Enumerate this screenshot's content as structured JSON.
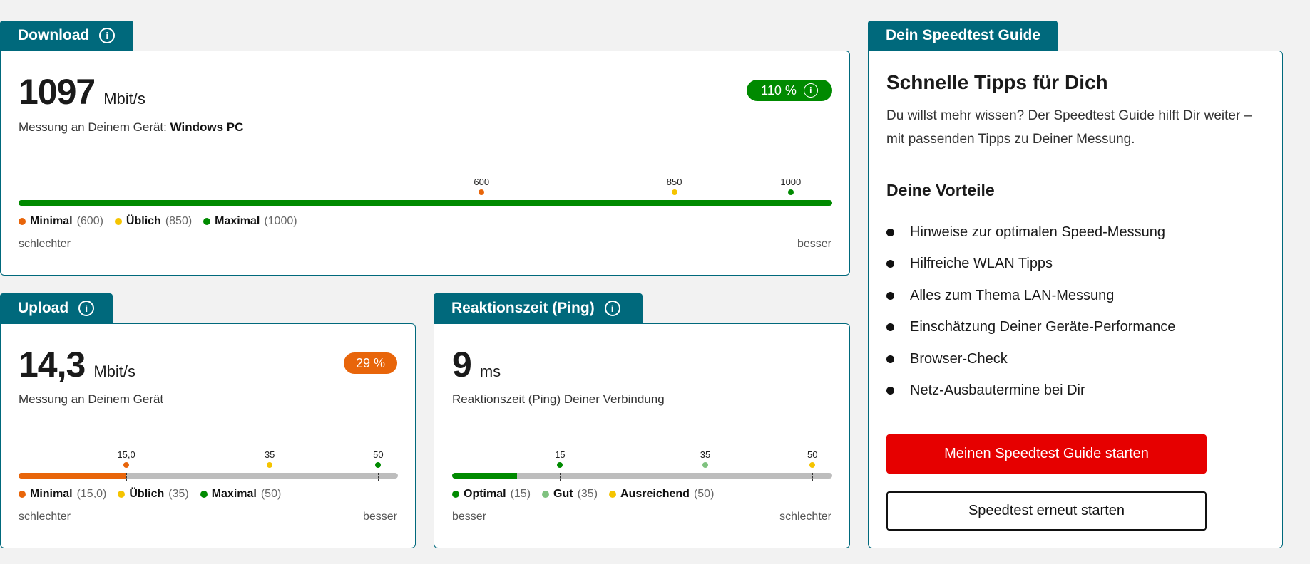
{
  "colors": {
    "teal": "#00697c",
    "green": "#008a00",
    "orange": "#e8650a",
    "yellow": "#f5c400",
    "lightgreen": "#7fc27f",
    "red": "#e60000",
    "track": "#bdbdbd"
  },
  "download": {
    "tab_label": "Download",
    "value": "1097",
    "unit": "Mbit/s",
    "device_prefix": "Messung an Deinem Gerät:",
    "device_name": "Windows PC",
    "badge": "110 %",
    "fill_fraction": 1.0,
    "markers": [
      {
        "label": "600",
        "fraction": 0.569,
        "color": "#e8650a"
      },
      {
        "label": "850",
        "fraction": 0.806,
        "color": "#f5c400"
      },
      {
        "label": "1000",
        "fraction": 0.949,
        "color": "#008a00"
      }
    ],
    "legend": [
      {
        "name": "Minimal",
        "value": "(600)",
        "color": "#e8650a"
      },
      {
        "name": "Üblich",
        "value": "(850)",
        "color": "#f5c400"
      },
      {
        "name": "Maximal",
        "value": "(1000)",
        "color": "#008a00"
      }
    ],
    "left_end": "schlechter",
    "right_end": "besser"
  },
  "upload": {
    "tab_label": "Upload",
    "value": "14,3",
    "unit": "Mbit/s",
    "device_text": "Messung an Deinem Gerät",
    "badge": "29 %",
    "fill_fraction": 0.284,
    "markers": [
      {
        "label": "15,0",
        "fraction": 0.284,
        "color": "#e8650a"
      },
      {
        "label": "35",
        "fraction": 0.662,
        "color": "#f5c400"
      },
      {
        "label": "50",
        "fraction": 0.948,
        "color": "#008a00"
      }
    ],
    "legend": [
      {
        "name": "Minimal",
        "value": "(15,0)",
        "color": "#e8650a"
      },
      {
        "name": "Üblich",
        "value": "(35)",
        "color": "#f5c400"
      },
      {
        "name": "Maximal",
        "value": "(50)",
        "color": "#008a00"
      }
    ],
    "left_end": "schlechter",
    "right_end": "besser"
  },
  "ping": {
    "tab_label": "Reaktionszeit (Ping)",
    "value": "9",
    "unit": "ms",
    "description": "Reaktionszeit (Ping) Deiner Verbindung",
    "fill_fraction": 0.17,
    "markers": [
      {
        "label": "15",
        "fraction": 0.284,
        "color": "#008a00"
      },
      {
        "label": "35",
        "fraction": 0.666,
        "color": "#7fc27f"
      },
      {
        "label": "50",
        "fraction": 0.948,
        "color": "#f5c400"
      }
    ],
    "legend": [
      {
        "name": "Optimal",
        "value": "(15)",
        "color": "#008a00"
      },
      {
        "name": "Gut",
        "value": "(35)",
        "color": "#7fc27f"
      },
      {
        "name": "Ausreichend",
        "value": "(50)",
        "color": "#f5c400"
      }
    ],
    "left_end": "besser",
    "right_end": "schlechter"
  },
  "guide": {
    "tab_label": "Dein Speedtest Guide",
    "title": "Schnelle Tipps für Dich",
    "description": "Du willst mehr wissen? Der Speedtest Guide hilft Dir weiter – mit passenden Tipps zu Deiner Messung.",
    "advantages_title": "Deine Vorteile",
    "advantages": [
      "Hinweise zur optimalen Speed-Messung",
      "Hilfreiche WLAN Tipps",
      "Alles zum Thema LAN-Messung",
      "Einschätzung Deiner Geräte-Performance",
      "Browser-Check",
      "Netz-Ausbautermine bei Dir"
    ],
    "primary_button": "Meinen Speedtest Guide starten",
    "secondary_button": "Speedtest erneut starten"
  }
}
